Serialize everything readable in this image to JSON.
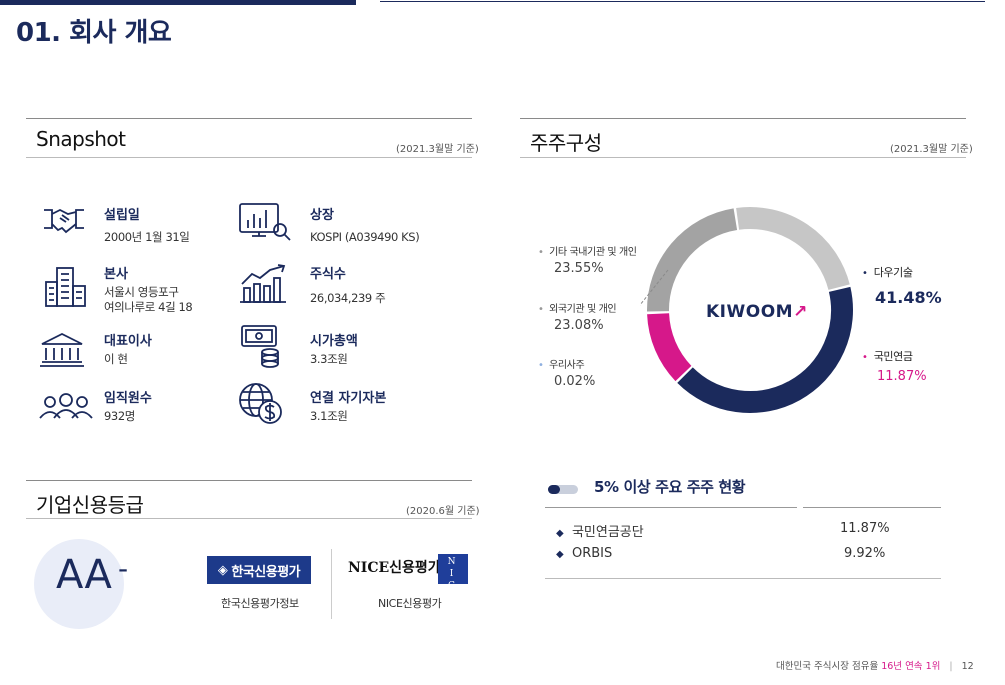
{
  "page_title": "01. 회사 개요",
  "snapshot": {
    "title": "Snapshot",
    "note": "(2021.3월말 기준)",
    "items": [
      {
        "label": "설립일",
        "value": "2000년 1월 31일",
        "icon": "handshake-icon"
      },
      {
        "label": "상장",
        "value": "KOSPI (A039490 KS)",
        "icon": "stock-chart-icon"
      },
      {
        "label": "본사",
        "value1": "서울시 영등포구",
        "value2": "여의나루로 4길 18",
        "icon": "building-icon"
      },
      {
        "label": "주식수",
        "value": "26,034,239 주",
        "icon": "growth-chart-icon"
      },
      {
        "label": "대표이사",
        "value": "이 현",
        "icon": "bank-icon"
      },
      {
        "label": "시가총액",
        "value": "3.3조원",
        "icon": "money-icon"
      },
      {
        "label": "임직원수",
        "value": "932명",
        "icon": "people-icon"
      },
      {
        "label": "연결 자기자본",
        "value": "3.1조원",
        "icon": "globe-dollar-icon"
      }
    ]
  },
  "shareholders": {
    "title": "주주구성",
    "note": "(2021.3월말 기준)",
    "logo_text": "KIWOOM",
    "labels": {
      "etc_label": "기타 국내기관 및 개인",
      "etc_pct": "23.55%",
      "foreign_label": "외국기관 및 개인",
      "foreign_pct": "23.08%",
      "treasury_label": "우리사주",
      "treasury_pct": "0.02%",
      "daou_label": "다우기술",
      "daou_pct": "41.48%",
      "nps_label": "국민연금",
      "nps_pct": "11.87%"
    }
  },
  "chart_data": {
    "type": "pie",
    "categories": [
      "다우기술",
      "국민연금",
      "우리사주",
      "외국기관 및 개인",
      "기타 국내기관 및 개인"
    ],
    "values": [
      41.48,
      11.87,
      0.02,
      23.08,
      23.55
    ],
    "colors": [
      "#1b2a5c",
      "#d6188a",
      "#cfcfcf",
      "#a3a3a3",
      "#c6c6c6"
    ]
  },
  "credit": {
    "title": "기업신용등급",
    "note": "(2020.6월 기준)",
    "grade_main": "AA",
    "grade_suffix": "-",
    "agency1_logo": "한국신용평가",
    "agency1_name": "한국신용평가정보",
    "agency2_logo": "NICE신용평가",
    "agency2_name": "NICE신용평가",
    "nice_box": "N I C E"
  },
  "major": {
    "title": "5% 이상 주요 주주 현황",
    "rows": [
      {
        "name": "국민연금공단",
        "pct": "11.87%"
      },
      {
        "name": "ORBIS",
        "pct": "9.92%"
      }
    ]
  },
  "footer": {
    "text": "대한민국 주식시장 점유율",
    "highlight": "16년 연속 1위",
    "sep": "|",
    "page": "12"
  }
}
